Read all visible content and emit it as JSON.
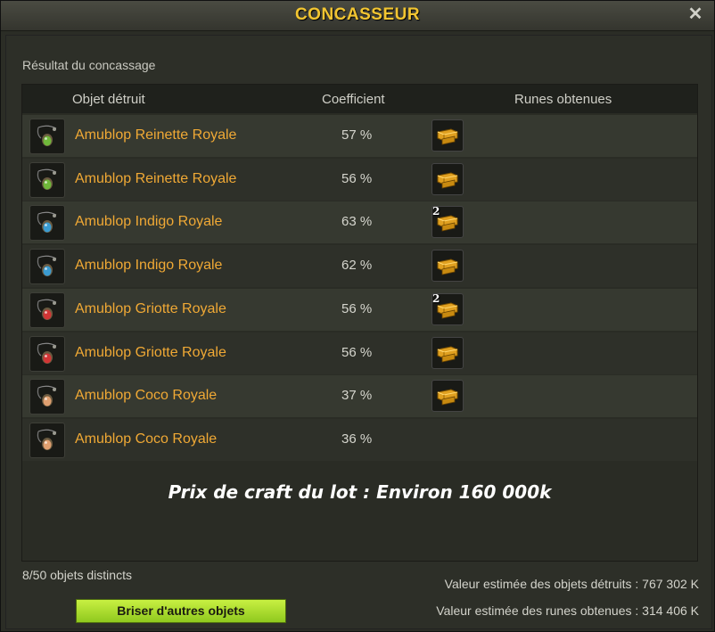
{
  "window": {
    "title": "CONCASSEUR",
    "close_symbol": "✕"
  },
  "section_label": "Résultat du concassage",
  "table": {
    "headers": {
      "object": "Objet détruit",
      "coefficient": "Coefficient",
      "runes": "Runes obtenues"
    },
    "rows": [
      {
        "name": "Amublop Reinette Royale",
        "coefficient": "57 %",
        "rune_count": "",
        "has_rune": true,
        "gem_color": "#6fb83a"
      },
      {
        "name": "Amublop Reinette Royale",
        "coefficient": "56 %",
        "rune_count": "",
        "has_rune": true,
        "gem_color": "#6fb83a"
      },
      {
        "name": "Amublop Indigo Royale",
        "coefficient": "63 %",
        "rune_count": "2",
        "has_rune": true,
        "gem_color": "#3a9bd0"
      },
      {
        "name": "Amublop Indigo Royale",
        "coefficient": "62 %",
        "rune_count": "",
        "has_rune": true,
        "gem_color": "#3a9bd0"
      },
      {
        "name": "Amublop Griotte Royale",
        "coefficient": "56 %",
        "rune_count": "2",
        "has_rune": true,
        "gem_color": "#d23535"
      },
      {
        "name": "Amublop Griotte Royale",
        "coefficient": "56 %",
        "rune_count": "",
        "has_rune": true,
        "gem_color": "#d23535"
      },
      {
        "name": "Amublop Coco Royale",
        "coefficient": "37 %",
        "rune_count": "",
        "has_rune": true,
        "gem_color": "#e0a070"
      },
      {
        "name": "Amublop Coco Royale",
        "coefficient": "36 %",
        "rune_count": "",
        "has_rune": false,
        "gem_color": "#e0a070"
      }
    ],
    "note": "Prix de craft du lot : Environ 160 000k"
  },
  "footer": {
    "count_text": "8/50 objets distincts",
    "button_label": "Briser d'autres objets",
    "value_destroyed": "Valeur estimée des objets détruits : 767 302 K",
    "value_runes": "Valeur estimée des runes obtenues : 314 406 K"
  },
  "colors": {
    "accent_title": "#f2c531",
    "item_name": "#f0a935",
    "button": "#a8dc2c"
  }
}
